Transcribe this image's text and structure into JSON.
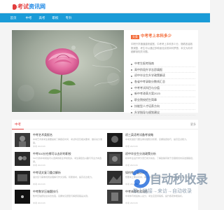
{
  "header": {
    "logo_part1": "考试",
    "logo_part2": "资讯网"
  },
  "nav": {
    "items": [
      {
        "label": "首页"
      },
      {
        "label": "中考"
      },
      {
        "label": "高考"
      },
      {
        "label": "职校"
      },
      {
        "label": "专升"
      }
    ]
  },
  "featured": {
    "badge": "头条",
    "title": "中考考上本科",
    "title_suffix": "多少",
    "description": "中职升学通道越来越宽，中考考上本科多少分，随着各省政策调整，考生可以通过多种途径实现本科梦想，本文为你详细解读相关问题。",
    "list": [
      "中考生报考指南",
      "高中阶段升学志愿填报",
      "初中毕业生升学政策解读",
      "各省中考录取分数线汇总",
      "中考考试科目与分值",
      "新中考改革方案2023",
      "职业院校招生简章",
      "技能型人才培养方向",
      "升学指导与规划建议"
    ]
  },
  "lower": {
    "tab_label": "中考",
    "more_label": "更多",
    "articles": [
      {
        "title": "中考艺术类报名",
        "desc": "中考艺术类考生需要提前了解报名时间、考试科目及相关要求，做好充分准备。",
        "meta": "中考  2023-06"
      },
      {
        "title": "初三英语考试备考攻略",
        "desc": "中考英语复习要注重基础知识积累，掌握答题技巧，提高应试能力。",
        "meta": "中考  2023-06"
      },
      {
        "title": "中考510分在哪可以去好的职校",
        "desc": "510分的中考成绩可以选择的职业学校较多，考生需结合兴趣与专业方向选择。",
        "meta": "中考  2023-06"
      },
      {
        "title": "初中毕业生分流政策分析",
        "desc": "初中毕业后升学分流已成为常态，了解政策有助于合理规划未来发展路径。",
        "meta": "中考  2023-06"
      },
      {
        "title": "中考语文复习重点解析",
        "desc": "语文复习需重视阅读理解与作文训练，积累素材，提高表达能力。",
        "meta": "中考  2023-06"
      },
      {
        "title": "如何考上重点高中",
        "desc": "想要考上重点高中，需要制定科学的学习计划，合理分配各科复习时间。",
        "meta": "中考  2023-06"
      },
      {
        "title": "中考数学压轴题技巧",
        "desc": "数学压轴题往往综合性强，掌握常见题型与解题思路是关键。",
        "meta": "中考  2023-06"
      },
      {
        "title": "中考体育考试项目",
        "desc": "中考体育成绩纳入总分，考生应坚持锻炼，提升各项体能指标。",
        "meta": "中考  2023-06"
      }
    ]
  },
  "watermark": {
    "title": "自动秒收录",
    "subtitle": "数上链接→来访→自动收录"
  },
  "colors": {
    "nav_bg": "#1a9bd7",
    "accent": "#f36d3b",
    "brand_red": "#e23d3d"
  }
}
